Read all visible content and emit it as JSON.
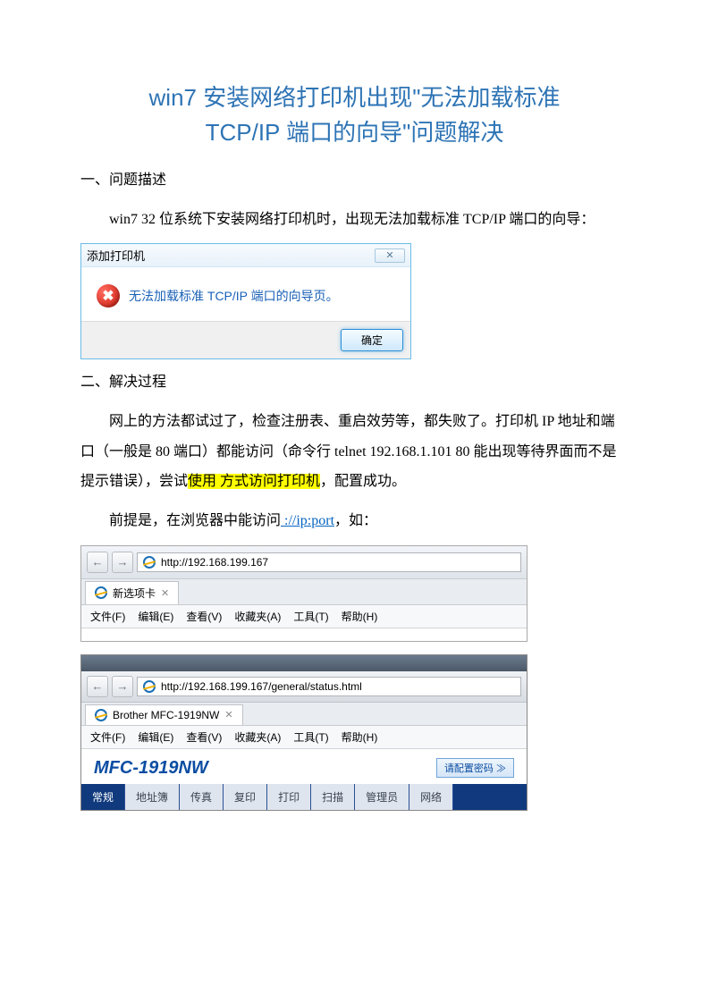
{
  "title_line1": "win7 安装网络打印机出现\"无法加载标准",
  "title_line2": "TCP/IP 端口的向导\"问题解决",
  "section1": "一、问题描述",
  "para1": "win7 32 位系统下安装网络打印机时，出现无法加载标准 TCP/IP 端口的向导：",
  "dialog": {
    "title": "添加打印机",
    "message": "无法加载标准 TCP/IP 端口的向导页。",
    "ok": "确定",
    "close": "✕"
  },
  "section2": "二、解决过程",
  "para2_a": "网上的方法都试过了，检查注册表、重启效劳等，都失败了。打印机 IP 地址和端口（一般是 80 端口）都能访问（命令行 telnet 192.168.1.101 80 能出现等待界面而不是提示错误），尝试",
  "para2_hl": "使用        方式访问打印机",
  "para2_b": "，配置成功。",
  "para3_a": "前提是，在浏览器中能访问",
  "para3_link": "     ://ip:port",
  "para3_b": "，如：",
  "ie1": {
    "url": "http://192.168.199.167",
    "tab": "新选项卡",
    "menu": [
      "文件(F)",
      "编辑(E)",
      "查看(V)",
      "收藏夹(A)",
      "工具(T)",
      "帮助(H)"
    ]
  },
  "ie2": {
    "url": "http://192.168.199.167/general/status.html",
    "tab": "Brother MFC-1919NW",
    "menu": [
      "文件(F)",
      "编辑(E)",
      "查看(V)",
      "收藏夹(A)",
      "工具(T)",
      "帮助(H)"
    ],
    "model": "MFC-1919NW",
    "config_btn": "请配置密码 ≫",
    "nav": [
      "常规",
      "地址簿",
      "传真",
      "复印",
      "打印",
      "扫描",
      "管理员",
      "网络"
    ]
  }
}
